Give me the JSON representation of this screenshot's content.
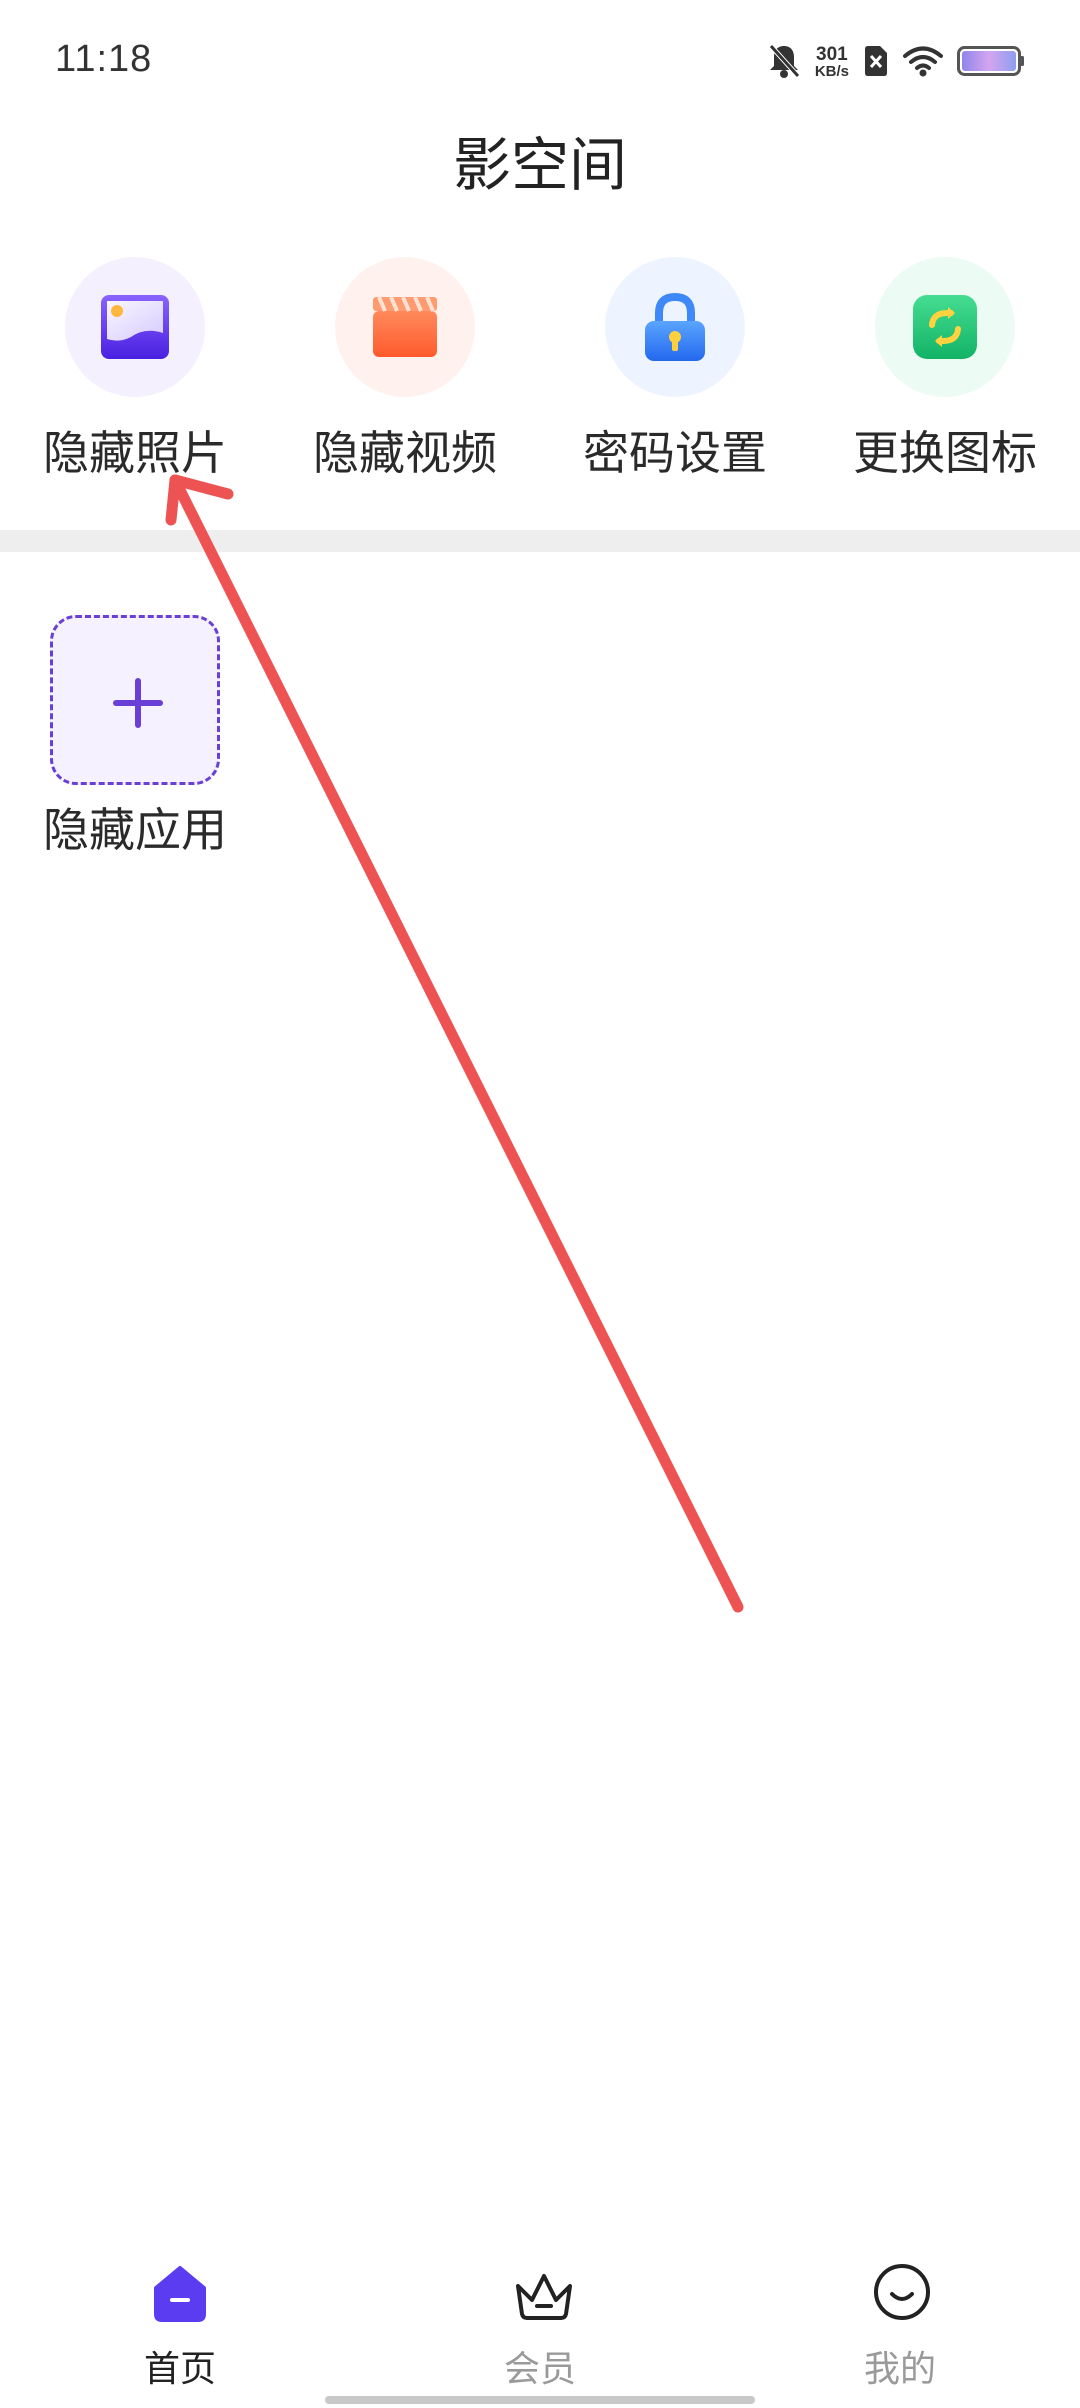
{
  "status_bar": {
    "time": "11:18",
    "net_speed_value": "301",
    "net_speed_unit": "KB/s",
    "icons": [
      "bell-muted-icon",
      "sim-off-icon",
      "wifi-icon",
      "battery-icon"
    ]
  },
  "header": {
    "title": "影空间"
  },
  "features": [
    {
      "label": "隐藏照片",
      "icon": "photo-icon",
      "color": "#5b3cf0"
    },
    {
      "label": "隐藏视频",
      "icon": "clapperboard-icon",
      "color": "#ff6a3d"
    },
    {
      "label": "密码设置",
      "icon": "lock-icon",
      "color": "#2f7bf5"
    },
    {
      "label": "更换图标",
      "icon": "swap-icon",
      "color": "#22c07a"
    }
  ],
  "hidden_apps": {
    "add_label": "隐藏应用",
    "add_icon": "plus-icon",
    "accent_color": "#6a3fd8"
  },
  "annotation": {
    "type": "arrow",
    "color": "#ee5353"
  },
  "bottom_nav": {
    "items": [
      {
        "label": "首页",
        "icon": "home-icon",
        "active": true
      },
      {
        "label": "会员",
        "icon": "crown-icon",
        "active": false
      },
      {
        "label": "我的",
        "icon": "smiley-icon",
        "active": false
      }
    ],
    "active_color": "#5b3cf0"
  }
}
